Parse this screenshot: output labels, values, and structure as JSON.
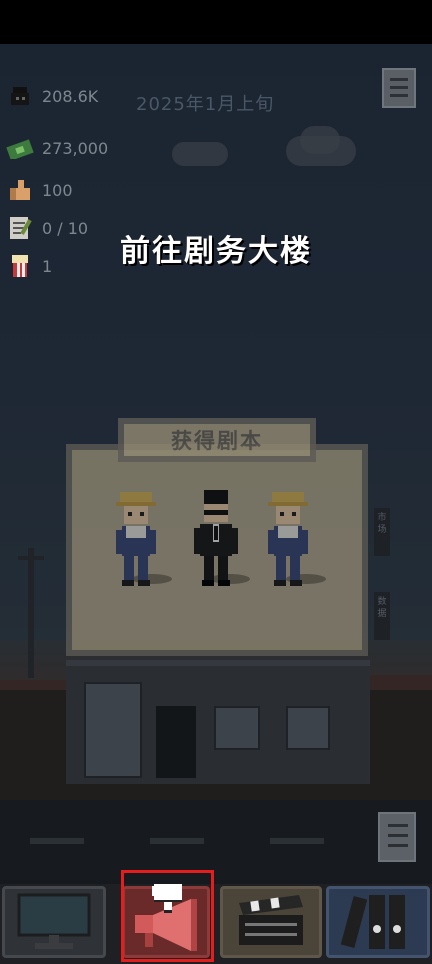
{
  "stats": {
    "fans": "208.6K",
    "money": "273,000",
    "likes": "100",
    "scripts": "0 / 10",
    "popcorn": "1"
  },
  "date": "2025年1月上旬",
  "hint_text": "前往剧务大楼",
  "board": {
    "title": "获得剧本"
  },
  "side_signs": {
    "market": "市场",
    "data": "数据"
  },
  "tabs": [
    {
      "name": "monitor",
      "icon": "computer-monitor-icon"
    },
    {
      "name": "promotion",
      "icon": "megaphone-icon"
    },
    {
      "name": "film",
      "icon": "clapperboard-icon"
    },
    {
      "name": "archive",
      "icon": "binders-icon"
    }
  ],
  "colors": {
    "highlight": "#e61d1d",
    "hint_text": "#ffffff"
  }
}
